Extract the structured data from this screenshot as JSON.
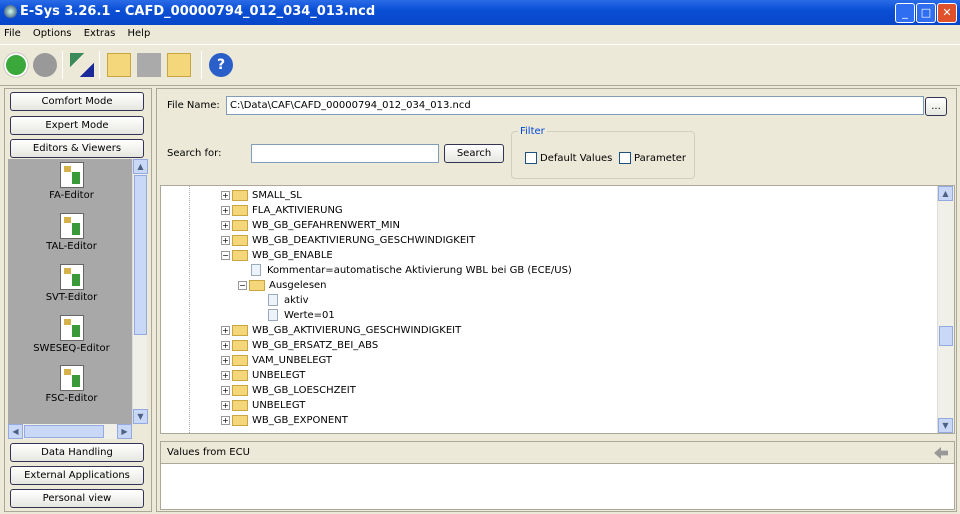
{
  "window": {
    "title": "E-Sys 3.26.1 - CAFD_00000794_012_034_013.ncd",
    "min": "_",
    "max": "□",
    "close": "✕"
  },
  "menu": [
    "File",
    "Options",
    "Extras",
    "Help"
  ],
  "toolbar": [
    "back-icon",
    "forward-icon",
    "connect-icon",
    "open-icon",
    "save-icon",
    "open-folder-icon",
    "help-icon"
  ],
  "left": {
    "top_buttons": [
      "Comfort Mode",
      "Expert Mode",
      "Editors & Viewers"
    ],
    "editors": [
      "FA-Editor",
      "TAL-Editor",
      "SVT-Editor",
      "SWESEQ-Editor",
      "FSC-Editor"
    ],
    "bottom_buttons": [
      "Data Handling",
      "External Applications",
      "Personal view"
    ]
  },
  "main": {
    "file_name_label": "File Name:",
    "file_name_value": "C:\\Data\\CAF\\CAFD_00000794_012_034_013.ncd",
    "browse_label": "...",
    "search_label": "Search for:",
    "search_value": "",
    "search_button": "Search",
    "filter": {
      "title": "Filter",
      "default_values": "Default Values",
      "parameter": "Parameter",
      "default_checked": false,
      "parameter_checked": false
    },
    "tree": [
      {
        "label": "SMALL_SL",
        "level": 0,
        "type": "folder",
        "expanded": false
      },
      {
        "label": "FLA_AKTIVIERUNG",
        "level": 0,
        "type": "folder",
        "expanded": false
      },
      {
        "label": "WB_GB_GEFAHRENWERT_MIN",
        "level": 0,
        "type": "folder",
        "expanded": false
      },
      {
        "label": "WB_GB_DEAKTIVIERUNG_GESCHWINDIGKEIT",
        "level": 0,
        "type": "folder",
        "expanded": false
      },
      {
        "label": "WB_GB_ENABLE",
        "level": 0,
        "type": "folder",
        "expanded": true
      },
      {
        "label": "Kommentar=automatische Aktivierung WBL bei GB (ECE/US)",
        "level": 1,
        "type": "doc"
      },
      {
        "label": "Ausgelesen",
        "level": 1,
        "type": "folder",
        "expanded": true
      },
      {
        "label": "aktiv",
        "level": 2,
        "type": "doc"
      },
      {
        "label": "Werte=01",
        "level": 2,
        "type": "doc"
      },
      {
        "label": "WB_GB_AKTIVIERUNG_GESCHWINDIGKEIT",
        "level": 0,
        "type": "folder",
        "expanded": false
      },
      {
        "label": "WB_GB_ERSATZ_BEI_ABS",
        "level": 0,
        "type": "folder",
        "expanded": false
      },
      {
        "label": "VAM_UNBELEGT",
        "level": 0,
        "type": "folder",
        "expanded": false
      },
      {
        "label": "UNBELEGT",
        "level": 0,
        "type": "folder",
        "expanded": false
      },
      {
        "label": "WB_GB_LOESCHZEIT",
        "level": 0,
        "type": "folder",
        "expanded": false
      },
      {
        "label": "UNBELEGT",
        "level": 0,
        "type": "folder",
        "expanded": false
      },
      {
        "label": "WB_GB_EXPONENT",
        "level": 0,
        "type": "folder",
        "expanded": false
      }
    ],
    "values_title": "Values from ECU"
  }
}
